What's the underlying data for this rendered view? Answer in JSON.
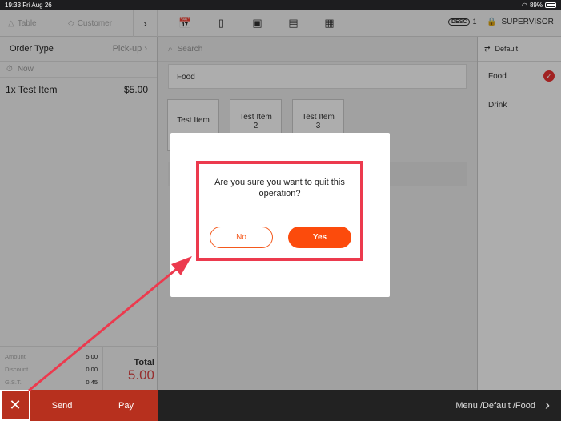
{
  "status_bar": {
    "time": "19:33",
    "date": "Fri Aug 26",
    "battery": "89%"
  },
  "top_bar": {
    "table_label": "Table",
    "customer_label": "Customer",
    "desc_badge": "DESC",
    "desc_count": "1",
    "supervisor_label": "SUPERVISOR",
    "icons": [
      "calendar-check-icon",
      "tablet-icon",
      "drawer-icon",
      "clipboard-icon",
      "user-card-icon"
    ]
  },
  "order_panel": {
    "order_type_label": "Order Type",
    "order_type_value": "Pick-up",
    "time_label": "Now",
    "items": [
      {
        "name": "1x Test Item",
        "price": "$5.00"
      }
    ],
    "totals": {
      "amount_label": "Amount",
      "amount_value": "5.00",
      "discount_label": "Discount",
      "discount_value": "0.00",
      "gst_label": "G.S.T.",
      "gst_value": "0.45",
      "total_label": "Total",
      "total_value": "5.00"
    }
  },
  "bottom_bar": {
    "send_label": "Send",
    "pay_label": "Pay",
    "menu_path": "Menu /Default /Food"
  },
  "menu_panel": {
    "search_placeholder": "Search",
    "category_bar": "Food",
    "tiles": [
      {
        "line1": "Test Item",
        "line2": ""
      },
      {
        "line1": "Test Item",
        "line2": "2"
      },
      {
        "line1": "Test Item",
        "line2": "3"
      }
    ]
  },
  "category_panel": {
    "header": "Default",
    "items": [
      {
        "label": "Food",
        "selected": true
      },
      {
        "label": "Drink",
        "selected": false
      }
    ]
  },
  "dialog": {
    "message": "Are you sure you want to quit this operation?",
    "no_label": "No",
    "yes_label": "Yes"
  },
  "colors": {
    "accent": "#fc4b0c",
    "highlight": "#ec3a4e",
    "action_bar": "#b7301e"
  }
}
